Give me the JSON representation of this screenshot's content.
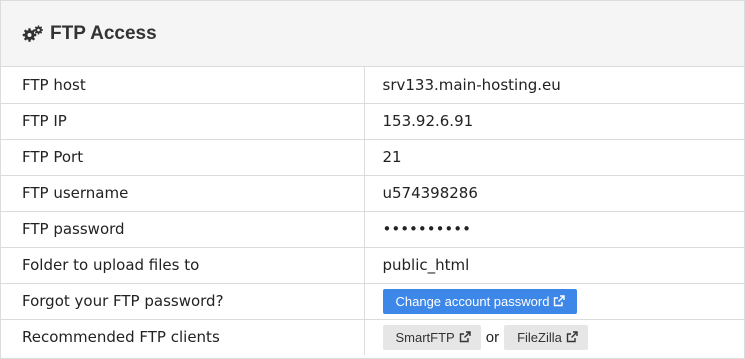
{
  "panel": {
    "title": "FTP Access",
    "icon": "gears-icon"
  },
  "rows": [
    {
      "label": "FTP host",
      "value": "srv133.main-hosting.eu"
    },
    {
      "label": "FTP IP",
      "value": "153.92.6.91"
    },
    {
      "label": "FTP Port",
      "value": "21"
    },
    {
      "label": "FTP username",
      "value": "u574398286"
    },
    {
      "label": "FTP password",
      "value": "••••••••••"
    },
    {
      "label": "Folder to upload files to",
      "value": "public_html"
    }
  ],
  "forgot": {
    "label": "Forgot your FTP password?",
    "button_label": "Change account password"
  },
  "clients": {
    "label": "Recommended FTP clients",
    "smartftp_label": "SmartFTP",
    "or_text": "or",
    "filezilla_label": "FileZilla"
  },
  "colors": {
    "primary_button": "#3d87e9",
    "secondary_button": "#e6e6e6",
    "header_background": "#f5f5f5"
  }
}
